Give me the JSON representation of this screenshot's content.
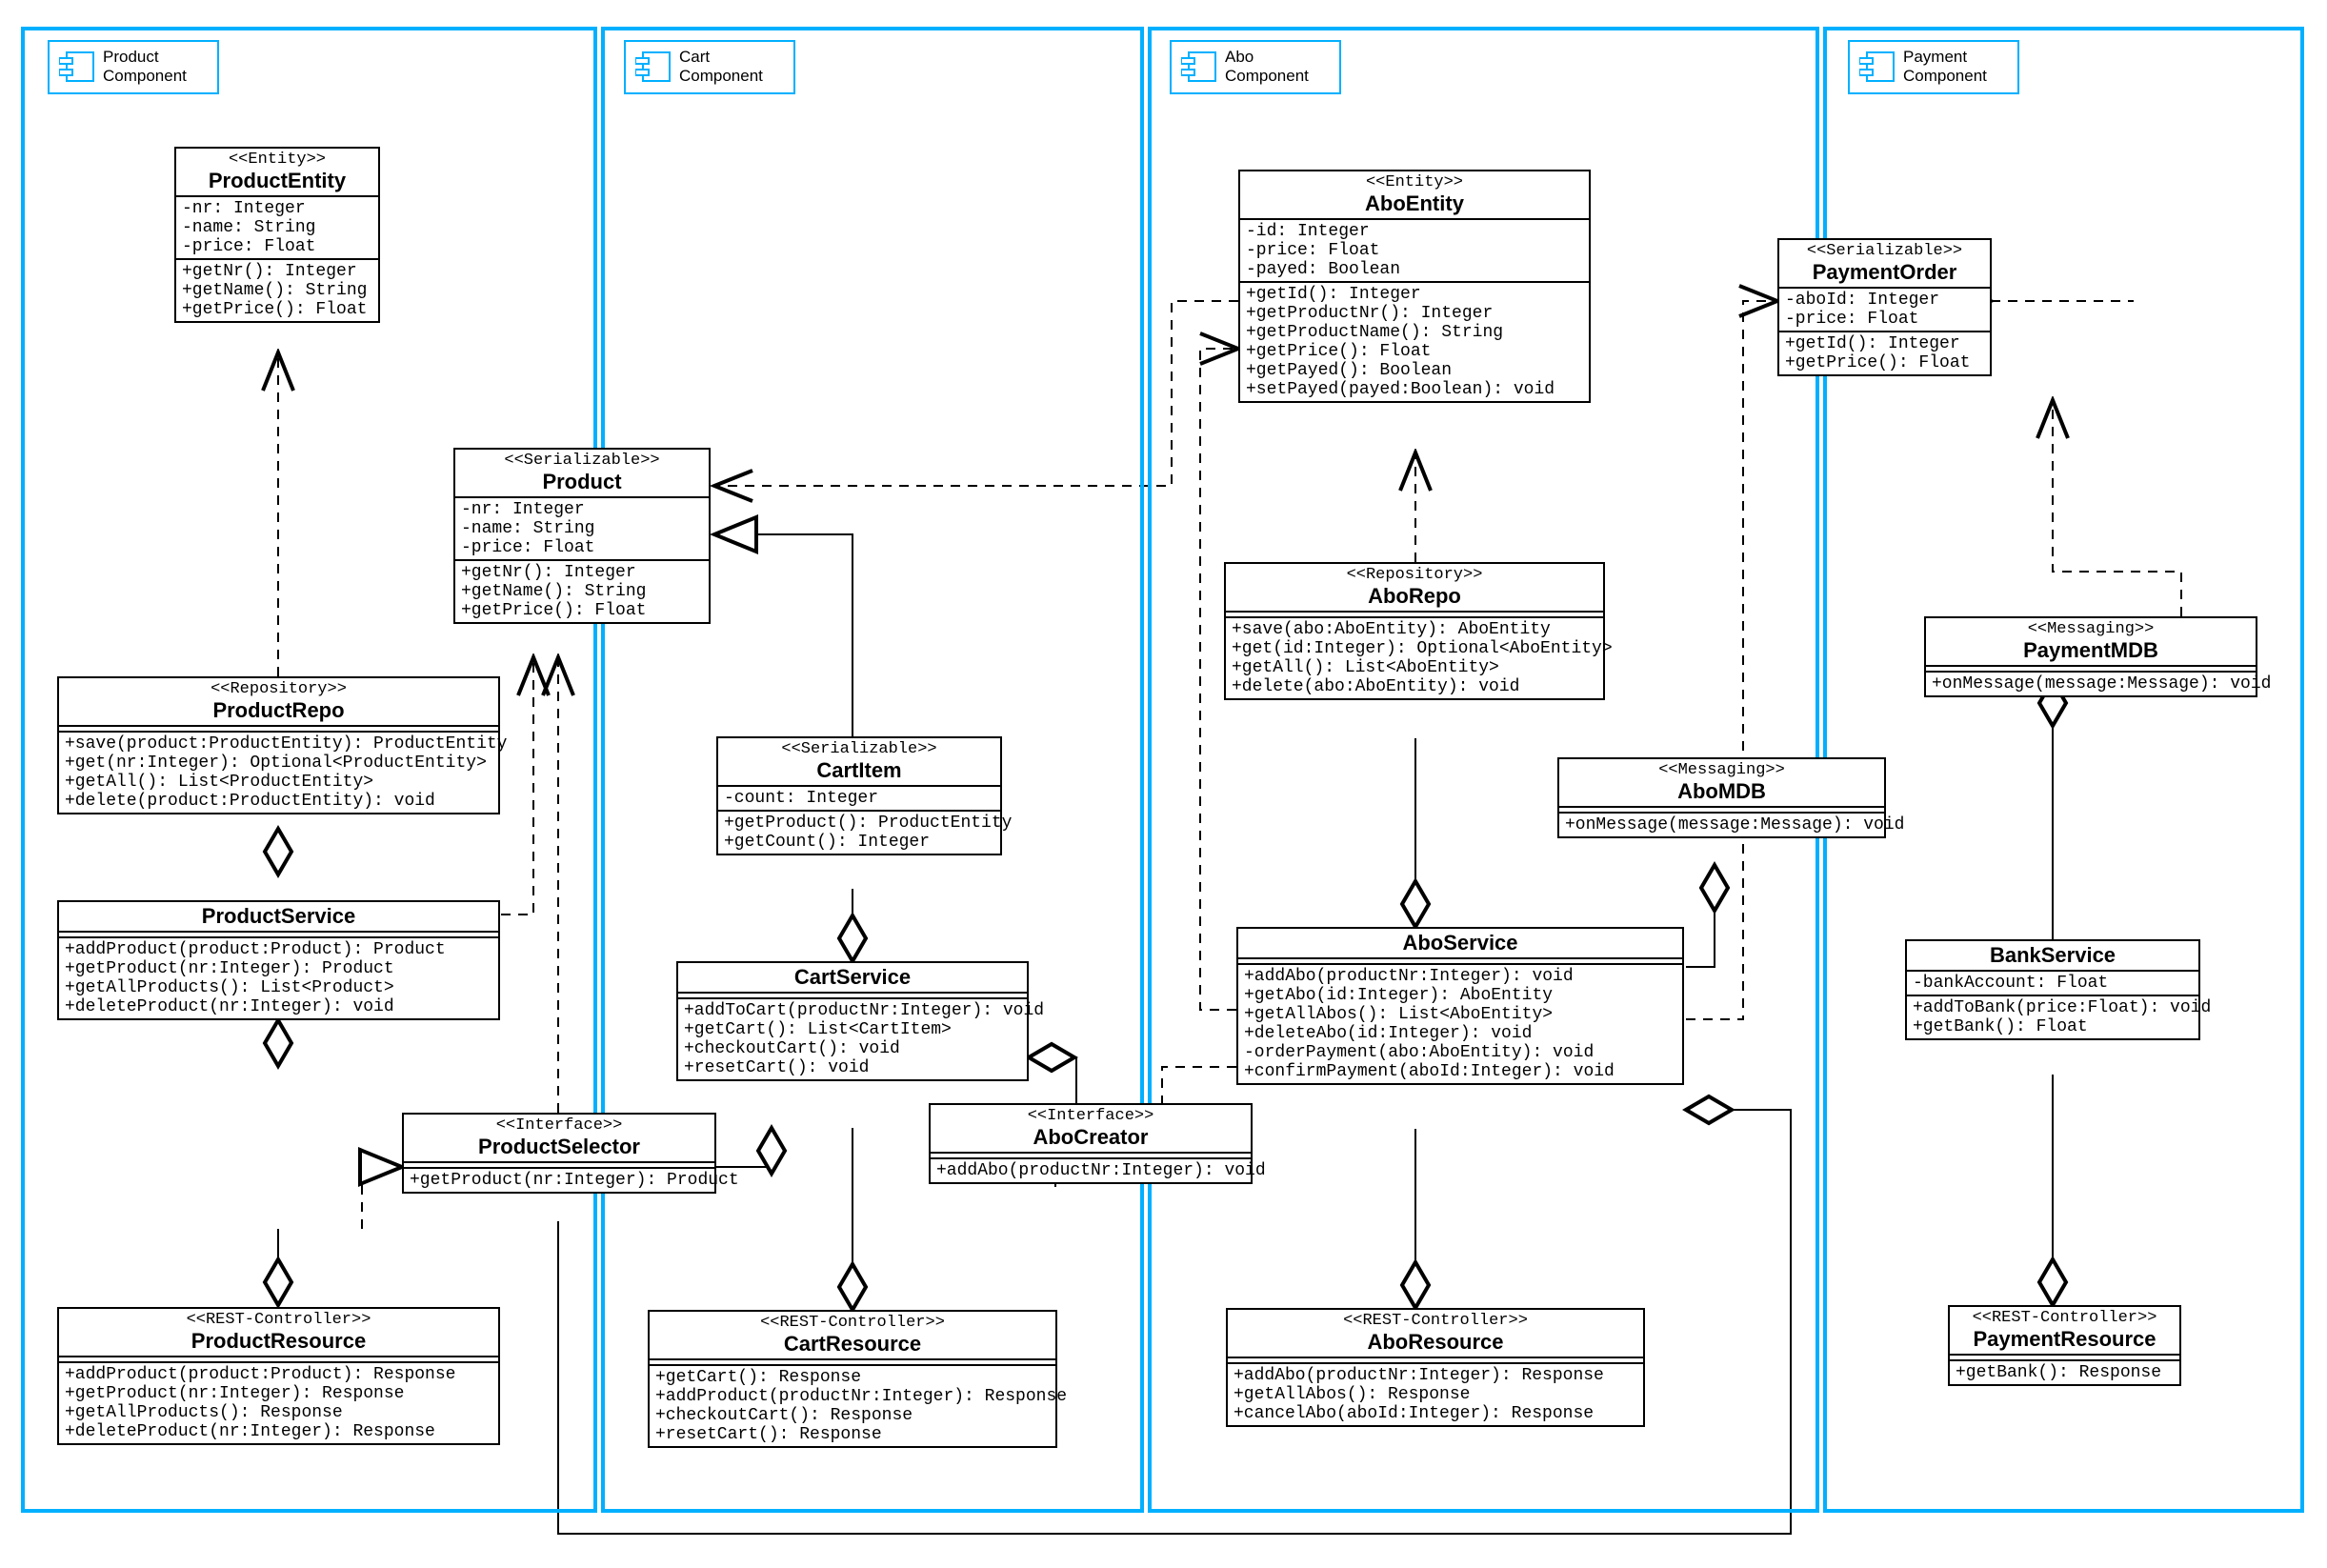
{
  "components": {
    "product": {
      "title": "Product\nComponent"
    },
    "cart": {
      "title": "Cart\nComponent"
    },
    "abo": {
      "title": "Abo\nComponent"
    },
    "payment": {
      "title": "Payment\nComponent"
    }
  },
  "classes": {
    "productEntity": {
      "stereo": "<<Entity>>",
      "name": "ProductEntity",
      "attrs": [
        "-nr: Integer",
        "-name: String",
        "-price: Float"
      ],
      "ops": [
        "+getNr(): Integer",
        "+getName(): String",
        "+getPrice(): Float"
      ]
    },
    "product": {
      "stereo": "<<Serializable>>",
      "name": "Product",
      "attrs": [
        "-nr: Integer",
        "-name: String",
        "-price: Float"
      ],
      "ops": [
        "+getNr(): Integer",
        "+getName(): String",
        "+getPrice(): Float"
      ]
    },
    "productRepo": {
      "stereo": "<<Repository>>",
      "name": "ProductRepo",
      "attrs": [],
      "ops": [
        "+save(product:ProductEntity): ProductEntity",
        "+get(nr:Integer): Optional<ProductEntity>",
        "+getAll(): List<ProductEntity>",
        "+delete(product:ProductEntity): void"
      ]
    },
    "productService": {
      "stereo": "",
      "name": "ProductService",
      "attrs": [],
      "ops": [
        "+addProduct(product:Product): Product",
        "+getProduct(nr:Integer): Product",
        "+getAllProducts(): List<Product>",
        "+deleteProduct(nr:Integer): void"
      ]
    },
    "productSelector": {
      "stereo": "<<Interface>>",
      "name": "ProductSelector",
      "attrs": [],
      "ops": [
        "+getProduct(nr:Integer): Product"
      ]
    },
    "productResource": {
      "stereo": "<<REST-Controller>>",
      "name": "ProductResource",
      "attrs": [],
      "ops": [
        "+addProduct(product:Product): Response",
        "+getProduct(nr:Integer): Response",
        "+getAllProducts(): Response",
        "+deleteProduct(nr:Integer): Response"
      ]
    },
    "cartItem": {
      "stereo": "<<Serializable>>",
      "name": "CartItem",
      "attrs": [
        "-count: Integer"
      ],
      "ops": [
        "+getProduct(): ProductEntity",
        "+getCount(): Integer"
      ]
    },
    "cartService": {
      "stereo": "",
      "name": "CartService",
      "attrs": [],
      "ops": [
        "+addToCart(productNr:Integer): void",
        "+getCart(): List<CartItem>",
        "+checkoutCart(): void",
        "+resetCart(): void"
      ]
    },
    "aboCreator": {
      "stereo": "<<Interface>>",
      "name": "AboCreator",
      "attrs": [],
      "ops": [
        "+addAbo(productNr:Integer): void"
      ]
    },
    "cartResource": {
      "stereo": "<<REST-Controller>>",
      "name": "CartResource",
      "attrs": [],
      "ops": [
        "+getCart(): Response",
        "+addProduct(productNr:Integer): Response",
        "+checkoutCart(): Response",
        "+resetCart(): Response"
      ]
    },
    "aboEntity": {
      "stereo": "<<Entity>>",
      "name": "AboEntity",
      "attrs": [
        "-id: Integer",
        "-price: Float",
        "-payed: Boolean"
      ],
      "ops": [
        "+getId(): Integer",
        "+getProductNr(): Integer",
        "+getProductName(): String",
        "+getPrice(): Float",
        "+getPayed(): Boolean",
        "+setPayed(payed:Boolean): void"
      ]
    },
    "aboRepo": {
      "stereo": "<<Repository>>",
      "name": "AboRepo",
      "attrs": [],
      "ops": [
        "+save(abo:AboEntity): AboEntity",
        "+get(id:Integer): Optional<AboEntity>",
        "+getAll(): List<AboEntity>",
        "+delete(abo:AboEntity): void"
      ]
    },
    "aboMDB": {
      "stereo": "<<Messaging>>",
      "name": "AboMDB",
      "attrs": [],
      "ops": [
        "+onMessage(message:Message): void"
      ]
    },
    "aboService": {
      "stereo": "",
      "name": "AboService",
      "attrs": [],
      "ops": [
        "+addAbo(productNr:Integer): void",
        "+getAbo(id:Integer): AboEntity",
        "+getAllAbos(): List<AboEntity>",
        "+deleteAbo(id:Integer): void",
        "-orderPayment(abo:AboEntity): void",
        "+confirmPayment(aboId:Integer): void"
      ]
    },
    "aboResource": {
      "stereo": "<<REST-Controller>>",
      "name": "AboResource",
      "attrs": [],
      "ops": [
        "+addAbo(productNr:Integer): Response",
        "+getAllAbos(): Response",
        "+cancelAbo(aboId:Integer): Response"
      ]
    },
    "paymentOrder": {
      "stereo": "<<Serializable>>",
      "name": "PaymentOrder",
      "attrs": [
        "-aboId: Integer",
        "-price: Float"
      ],
      "ops": [
        "+getId(): Integer",
        "+getPrice(): Float"
      ]
    },
    "paymentMDB": {
      "stereo": "<<Messaging>>",
      "name": "PaymentMDB",
      "attrs": [],
      "ops": [
        "+onMessage(message:Message): void"
      ]
    },
    "bankService": {
      "stereo": "",
      "name": "BankService",
      "attrs": [
        "-bankAccount: Float"
      ],
      "ops": [
        "+addToBank(price:Float): void",
        "+getBank(): Float"
      ]
    },
    "paymentResource": {
      "stereo": "<<REST-Controller>>",
      "name": "PaymentResource",
      "attrs": [],
      "ops": [
        "+getBank(): Response"
      ]
    }
  }
}
